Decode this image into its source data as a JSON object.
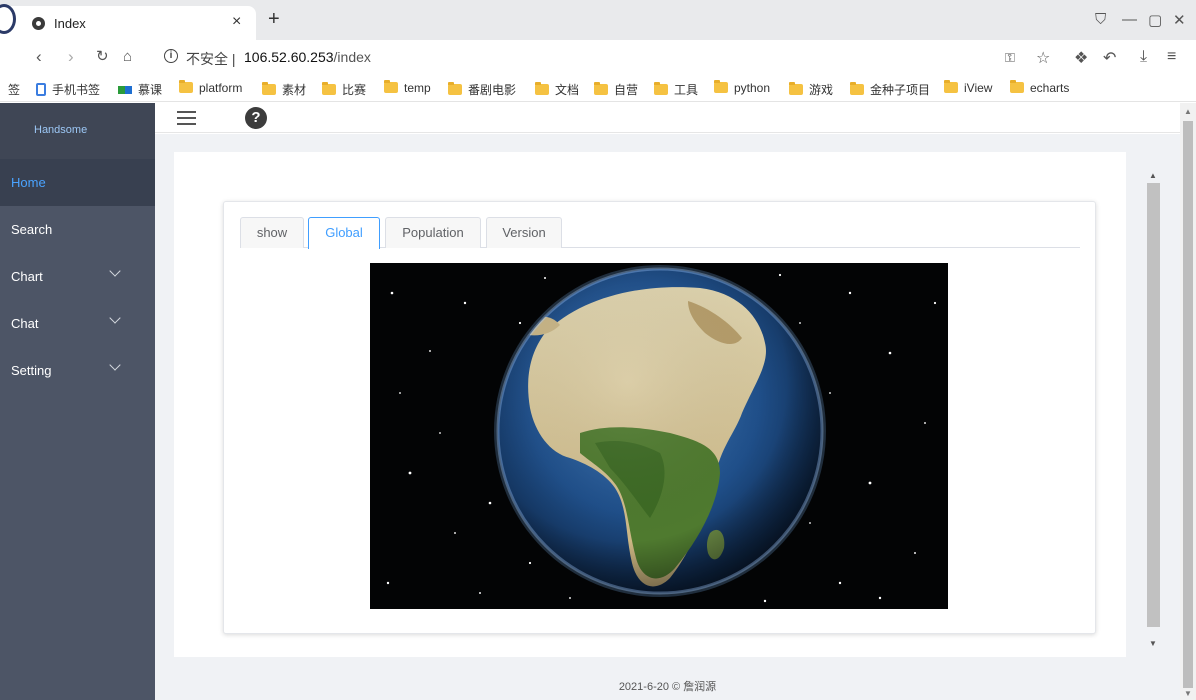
{
  "browser": {
    "tab_title": "Index",
    "tab_close": "×",
    "new_tab": "+",
    "security_label": "不安全 |",
    "url_host": "106.52.60.253",
    "url_path": "/index",
    "window_controls": [
      "⛉",
      "—",
      "▢",
      "✕"
    ]
  },
  "bookmarks": [
    {
      "label": "签",
      "icon": "text"
    },
    {
      "label": "手机书签",
      "icon": "phone-icon"
    },
    {
      "label": "慕课",
      "icon": "mooc-icon"
    },
    {
      "label": "platform",
      "icon": "folder-icon"
    },
    {
      "label": "素材",
      "icon": "folder-icon"
    },
    {
      "label": "比赛",
      "icon": "folder-icon"
    },
    {
      "label": "temp",
      "icon": "folder-icon"
    },
    {
      "label": "番剧电影",
      "icon": "folder-icon"
    },
    {
      "label": "文档",
      "icon": "folder-icon"
    },
    {
      "label": "自营",
      "icon": "folder-icon"
    },
    {
      "label": "工具",
      "icon": "folder-icon"
    },
    {
      "label": "python",
      "icon": "folder-icon"
    },
    {
      "label": "游戏",
      "icon": "folder-icon"
    },
    {
      "label": "金种子项目",
      "icon": "folder-icon"
    },
    {
      "label": "iView",
      "icon": "folder-icon"
    },
    {
      "label": "echarts",
      "icon": "folder-icon"
    }
  ],
  "sidebar": {
    "brand": "Handsome",
    "items": [
      {
        "label": "Home",
        "active": true,
        "expandable": false
      },
      {
        "label": "Search",
        "active": false,
        "expandable": false
      },
      {
        "label": "Chart",
        "active": false,
        "expandable": true
      },
      {
        "label": "Chat",
        "active": false,
        "expandable": true
      },
      {
        "label": "Setting",
        "active": false,
        "expandable": true
      }
    ]
  },
  "topbar": {
    "help_glyph": "?"
  },
  "tabs": [
    {
      "label": "show",
      "active": false
    },
    {
      "label": "Global",
      "active": true
    },
    {
      "label": "Population",
      "active": false
    },
    {
      "label": "Version",
      "active": false
    }
  ],
  "footer": "2021-6-20 © 詹润源",
  "colors": {
    "sidebar": "#4d5566",
    "sidebar_active": "#384050",
    "accent": "#409eff",
    "brand_text": "#9cc7f5"
  }
}
